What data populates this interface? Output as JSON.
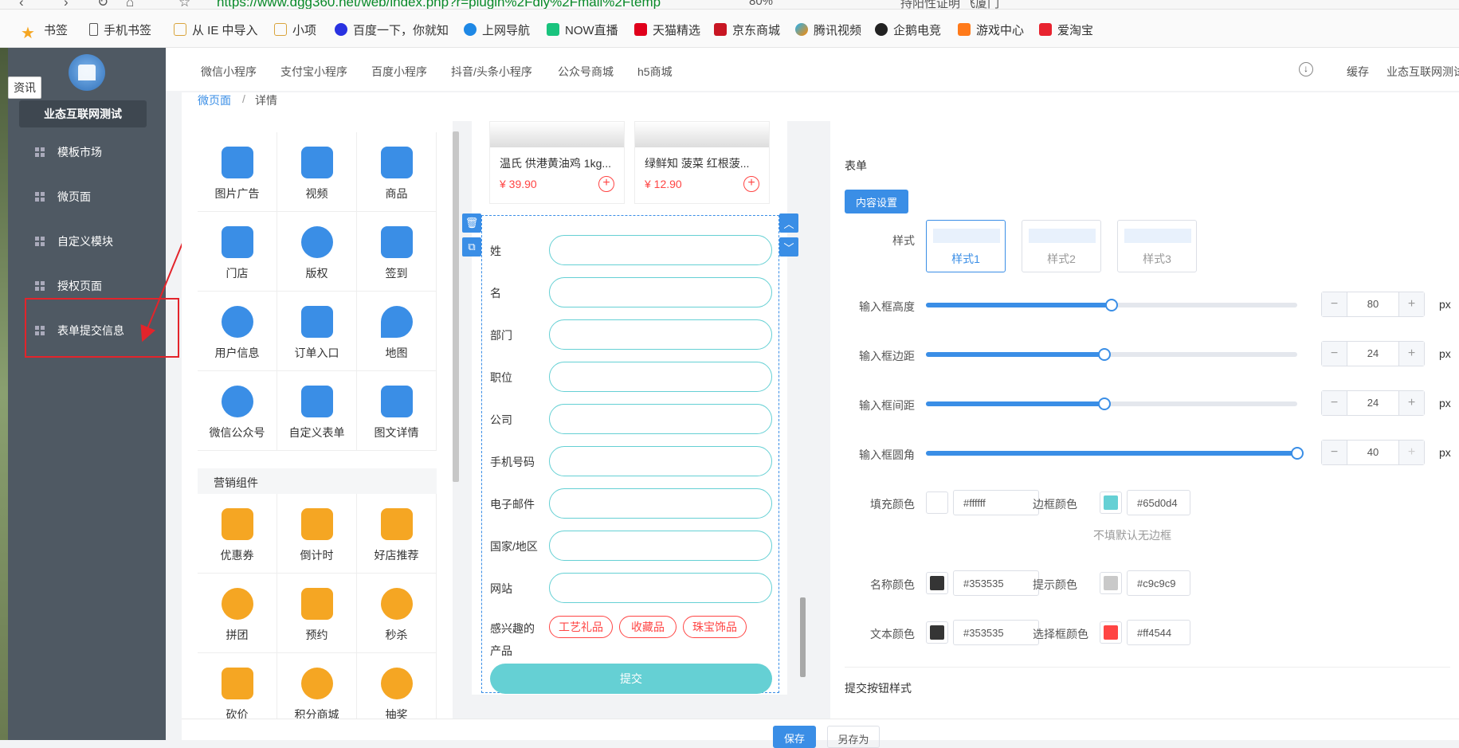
{
  "browser": {
    "url": "https://www.dgg360.net/web/index.php?r=plugin%2Fdiy%2Fmall%2Ftemp",
    "zoom": "80%",
    "search_text": "持阳性证明 飞厦门"
  },
  "bookmarks": [
    {
      "label": "书签",
      "icon": "star-icon"
    },
    {
      "label": "手机书签",
      "icon": "phone-icon"
    },
    {
      "label": "从 IE 中导入",
      "icon": "folder-icon"
    },
    {
      "label": "小项",
      "icon": "folder-icon"
    },
    {
      "label": "百度一下，你就知",
      "icon": "baidu-icon"
    },
    {
      "label": "上网导航",
      "icon": "ie-icon"
    },
    {
      "label": "NOW直播",
      "icon": "now-icon"
    },
    {
      "label": "天猫精选",
      "icon": "tmall-icon"
    },
    {
      "label": "京东商城",
      "icon": "jd-icon"
    },
    {
      "label": "腾讯视频",
      "icon": "tencent-video-icon"
    },
    {
      "label": "企鹅电竞",
      "icon": "penguin-icon"
    },
    {
      "label": "游戏中心",
      "icon": "gamepad-icon"
    },
    {
      "label": "爱淘宝",
      "icon": "taobao-icon"
    }
  ],
  "sidebar": {
    "brand": "业态互联网测试",
    "tooltip": "资讯",
    "items": [
      {
        "label": "模板市场"
      },
      {
        "label": "微页面"
      },
      {
        "label": "自定义模块"
      },
      {
        "label": "授权页面"
      },
      {
        "label": "表单提交信息"
      }
    ]
  },
  "topnav": {
    "tabs": [
      "微信小程序",
      "支付宝小程序",
      "百度小程序",
      "抖音/头条小程序",
      "公众号商城",
      "h5商城"
    ],
    "cache": "缓存",
    "user": "业态互联网测试"
  },
  "breadcrumb": {
    "root": "微页面",
    "sep": "/",
    "current": "详情"
  },
  "widgets": {
    "basic": [
      {
        "label": "图片广告",
        "color": "#3a8ee6"
      },
      {
        "label": "视频",
        "color": "#3a8ee6"
      },
      {
        "label": "商品",
        "color": "#3a8ee6"
      },
      {
        "label": "门店",
        "color": "#3a8ee6"
      },
      {
        "label": "版权",
        "color": "#3a8ee6"
      },
      {
        "label": "签到",
        "color": "#3a8ee6"
      },
      {
        "label": "用户信息",
        "color": "#3a8ee6"
      },
      {
        "label": "订单入口",
        "color": "#3a8ee6"
      },
      {
        "label": "地图",
        "color": "#3a8ee6"
      },
      {
        "label": "微信公众号",
        "color": "#3a8ee6"
      },
      {
        "label": "自定义表单",
        "color": "#3a8ee6"
      },
      {
        "label": "图文详情",
        "color": "#3a8ee6"
      }
    ],
    "marketing_title": "营销组件",
    "marketing": [
      {
        "label": "优惠券",
        "color": "#f5a623"
      },
      {
        "label": "倒计时",
        "color": "#f5a623"
      },
      {
        "label": "好店推荐",
        "color": "#f5a623"
      },
      {
        "label": "拼团",
        "color": "#f5a623"
      },
      {
        "label": "预约",
        "color": "#f5a623"
      },
      {
        "label": "秒杀",
        "color": "#f5a623"
      },
      {
        "label": "砍价",
        "color": "#f5a623"
      },
      {
        "label": "积分商城",
        "color": "#f5a623"
      },
      {
        "label": "抽奖",
        "color": "#f5a623"
      }
    ]
  },
  "preview": {
    "products": [
      {
        "title": "温氏 供港黄油鸡 1kg...",
        "price": "¥ 39.90"
      },
      {
        "title": "绿鲜知 菠菜 红根菠...",
        "price": "¥ 12.90"
      }
    ],
    "fields": [
      "姓",
      "名",
      "部门",
      "职位",
      "公司",
      "手机号码",
      "电子邮件",
      "国家/地区",
      "网站"
    ],
    "interest_label_1": "感兴趣的",
    "interest_label_2": "产品",
    "chips": [
      "工艺礼品",
      "收藏品",
      "珠宝饰品"
    ],
    "submit": "提交"
  },
  "props": {
    "title": "表单",
    "content_btn": "内容设置",
    "style_label": "样式",
    "styles": [
      "样式1",
      "样式2",
      "样式3"
    ],
    "sliders": [
      {
        "label": "输入框高度",
        "value": "80",
        "fraction": 0.5
      },
      {
        "label": "输入框边距",
        "value": "24",
        "fraction": 0.48
      },
      {
        "label": "输入框间距",
        "value": "24",
        "fraction": 0.48
      },
      {
        "label": "输入框圆角",
        "value": "40",
        "fraction": 1.0
      }
    ],
    "unit": "px",
    "fill_color_label": "填充颜色",
    "fill_color": "#ffffff",
    "border_color_label": "边框颜色",
    "border_color": "#65d0d4",
    "no_border_hint": "不填默认无边框",
    "name_color_label": "名称颜色",
    "name_color": "#353535",
    "hint_color_label": "提示颜色",
    "hint_color": "#c9c9c9",
    "text_color_label": "文本颜色",
    "text_color": "#353535",
    "select_color_label": "选择框颜色",
    "select_color": "#ff4544",
    "submit_style_title": "提交按钮样式"
  },
  "footer": {
    "save": "保存",
    "save_as": "另存为"
  }
}
